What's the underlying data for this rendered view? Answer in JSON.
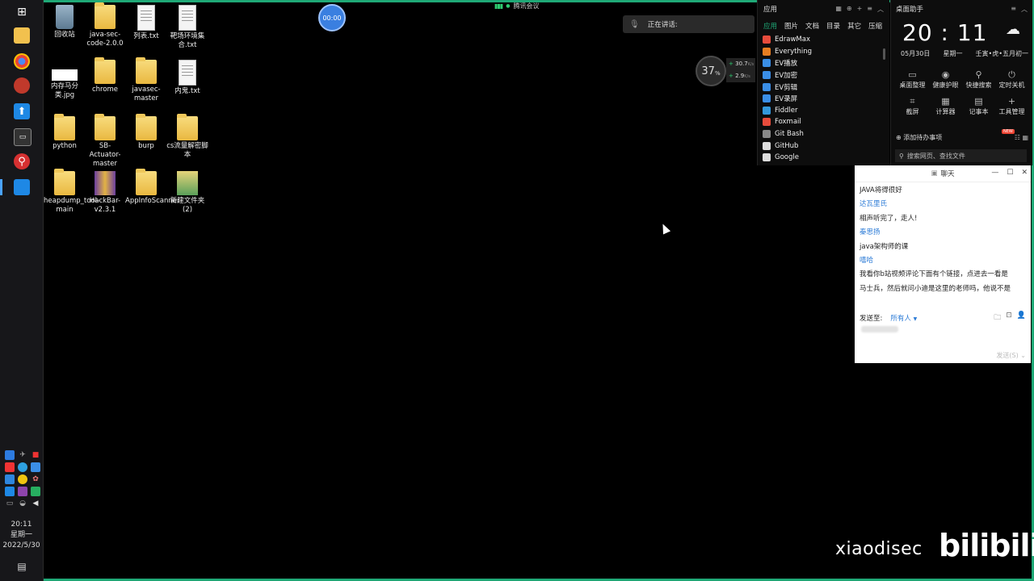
{
  "taskbar": {
    "clock": {
      "time": "20:11",
      "weekday": "星期一",
      "date": "2022/5/30"
    }
  },
  "desktop": {
    "icons": [
      {
        "label": "回收站",
        "type": "recycle"
      },
      {
        "label": "java-sec-code-2.0.0",
        "type": "folder"
      },
      {
        "label": "列表.txt",
        "type": "txt"
      },
      {
        "label": "靶场环境集合.txt",
        "type": "txt"
      },
      {
        "label": "内存马分类.jpg",
        "type": "image"
      },
      {
        "label": "chrome",
        "type": "folder"
      },
      {
        "label": "javasec-master",
        "type": "folder"
      },
      {
        "label": "内鬼.txt",
        "type": "txt"
      },
      {
        "label": "python",
        "type": "folder"
      },
      {
        "label": "SB-Actuator-master",
        "type": "folder"
      },
      {
        "label": "burp",
        "type": "folder"
      },
      {
        "label": "cs流量解密脚本",
        "type": "folder"
      },
      {
        "label": "heapdump_tool-main",
        "type": "folder"
      },
      {
        "label": "HackBar-v2.3.1",
        "type": "rar"
      },
      {
        "label": "AppInfoScanner",
        "type": "folder"
      },
      {
        "label": "新建文件夹 (2)",
        "type": "green"
      }
    ]
  },
  "meeting": {
    "timer": "00:00",
    "title": "腾讯会议",
    "talking": "正在讲话:"
  },
  "network": {
    "percent": "37",
    "percent_unit": "%",
    "upload": "30.7",
    "upload_unit": "K/s",
    "download": "2.9",
    "download_unit": "K/s"
  },
  "apps_panel": {
    "title": "应用",
    "tabs": [
      "应用",
      "图片",
      "文档",
      "目录",
      "其它",
      "压缩"
    ],
    "active_tab": 0,
    "items": [
      {
        "label": "EdrawMax",
        "color": "#e74c3c"
      },
      {
        "label": "Everything",
        "color": "#e67e22"
      },
      {
        "label": "EV播放",
        "color": "#3a8ee6"
      },
      {
        "label": "EV加密",
        "color": "#3a8ee6"
      },
      {
        "label": "EV剪辑",
        "color": "#3a8ee6"
      },
      {
        "label": "EV录屏",
        "color": "#3a8ee6"
      },
      {
        "label": "Fiddler",
        "color": "#3498db"
      },
      {
        "label": "Foxmail",
        "color": "#e74c3c"
      },
      {
        "label": "Git Bash",
        "color": "#888888"
      },
      {
        "label": "GitHub",
        "color": "#dddddd"
      },
      {
        "label": "Google",
        "color": "#dddddd"
      }
    ]
  },
  "assistant": {
    "title": "桌面助手",
    "time": "20 : 11",
    "date": "05月30日",
    "weekday": "星期一",
    "lunar": "壬寅•虎•五月初一",
    "tools": [
      {
        "label": "桌面整理",
        "icon": "desktop-icon"
      },
      {
        "label": "健康护眼",
        "icon": "eye-icon"
      },
      {
        "label": "快捷搜索",
        "icon": "search-icon"
      },
      {
        "label": "定时关机",
        "icon": "power-icon"
      },
      {
        "label": "截屏",
        "icon": "crop-icon"
      },
      {
        "label": "计算器",
        "icon": "calculator-icon"
      },
      {
        "label": "记事本",
        "icon": "notepad-icon"
      },
      {
        "label": "工具管理",
        "icon": "plus-icon"
      }
    ],
    "todo": "添加待办事项",
    "new_badge": "NEW",
    "search_placeholder": "搜索网页、查找文件"
  },
  "chat": {
    "title": "聊天",
    "messages": [
      {
        "kind": "text",
        "text": "JAVA将得很好"
      },
      {
        "kind": "name",
        "text": "达瓦里氏"
      },
      {
        "kind": "text",
        "text": "相声听完了，走人!"
      },
      {
        "kind": "name",
        "text": "秦思扬"
      },
      {
        "kind": "text",
        "text": "java架构师的课"
      },
      {
        "kind": "name",
        "text": "嘻哈"
      },
      {
        "kind": "text",
        "text": "我看你b站视频评论下面有个链接，点进去一看是"
      },
      {
        "kind": "text",
        "text": "马士兵，然后就问小迪是这里的老师吗，他说不是"
      }
    ],
    "send_to_label": "发送至:",
    "send_to_value": "所有人",
    "send_button": "发送(S)"
  },
  "watermark": {
    "author": "xiaodisec",
    "brand": "bilibili"
  }
}
